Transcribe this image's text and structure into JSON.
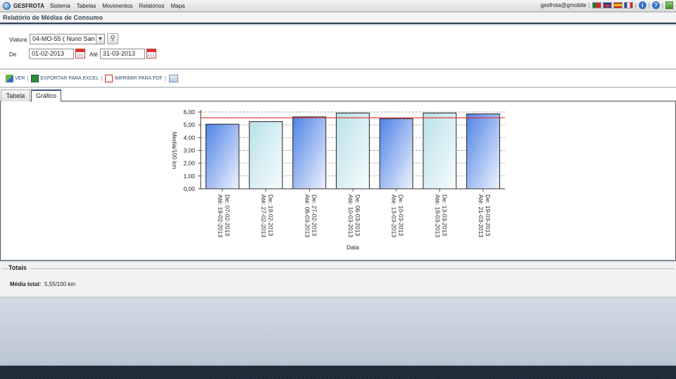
{
  "app": {
    "brand": "GESFROTA",
    "menu": [
      "Sistema",
      "Tabelas",
      "Movimentos",
      "Relatórios",
      "Mapa"
    ],
    "user": "gesfrota@gmobile"
  },
  "page_title": "Relatório de Médias de Consumo",
  "filters": {
    "viatura_label": "Viatura",
    "viatura_value": "04-MO-55 ( Nuno San",
    "de_label": "De",
    "de_value": "01-02-2013",
    "ate_label": "Até",
    "ate_value": "31-03-2013"
  },
  "toolbar": {
    "ver": "VER",
    "excel": "EXPORTAR PARA EXCEL",
    "pdf": "IMPRIMIR PARA PDF"
  },
  "tabs": [
    {
      "label": "Tabela",
      "active": false
    },
    {
      "label": "Gráfico",
      "active": true
    }
  ],
  "chart_data": {
    "type": "bar",
    "categories": [
      [
        "De: 07-02-2013",
        "Até: 19-02-2013"
      ],
      [
        "De: 19-02-2013",
        "Até: 27-02-2013"
      ],
      [
        "De: 27-02-2013",
        "Até: 06-03-2013"
      ],
      [
        "De: 06-03-2013",
        "Até: 10-03-2013"
      ],
      [
        "De: 10-03-2013",
        "Até: 13-03-2013"
      ],
      [
        "De: 13-03-2013",
        "Até: 19-03-2013"
      ],
      [
        "De: 19-03-2013",
        "Até: 21-03-2013"
      ]
    ],
    "values": [
      5.05,
      5.25,
      5.62,
      5.92,
      5.48,
      5.92,
      5.85
    ],
    "average_line": 5.55,
    "ylabel": "Media/100 km",
    "xlabel": "Data",
    "ylim": [
      0,
      6
    ],
    "yticks": [
      "0,00",
      "1,00",
      "2,00",
      "3,00",
      "4,00",
      "5,00",
      "6,00"
    ],
    "grid": true,
    "colors": {
      "bar_a": "#5c8ee8",
      "bar_b": "#c3e6ec",
      "avg_line": "#e03030"
    }
  },
  "totals": {
    "title": "Totais",
    "label": "Média total:",
    "value": "5,55/100 km"
  }
}
